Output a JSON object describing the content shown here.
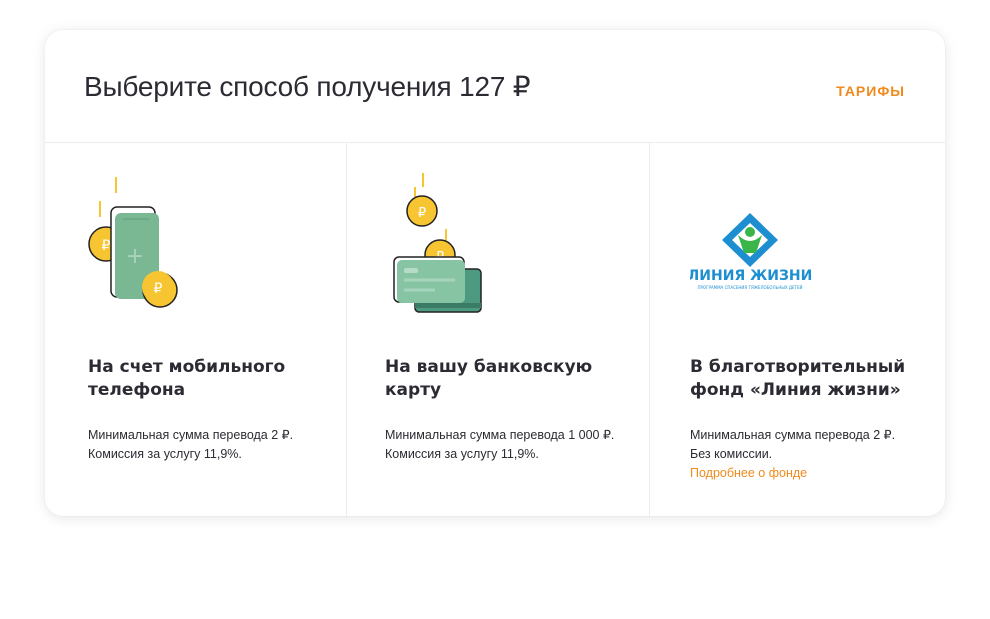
{
  "header": {
    "title": "Выберите способ получения 127 ₽",
    "tariffs_link": "ТАРИФЫ"
  },
  "options": [
    {
      "icon": "phone-with-coins-icon",
      "title": "На счет мобильного телефона",
      "min_amount": "Минимальная сумма перевода 2 ₽.",
      "commission": "Комиссия за услугу 11,9%."
    },
    {
      "icon": "bank-cards-with-coins-icon",
      "title": "На вашу банковскую карту",
      "min_amount": "Минимальная сумма перевода 1 000 ₽.",
      "commission": "Комиссия за услугу 11,9%."
    },
    {
      "icon": "liniya-zhizni-logo",
      "logo_text": "ЛИНИЯ ЖИЗНИ",
      "logo_subtitle": "ПРОГРАММА СПАСЕНИЯ ТЯЖЕЛОБОЛЬНЫХ ДЕТЕЙ",
      "title": "В благотворительный фонд «Линия жизни»",
      "min_amount": "Минимальная сумма перевода 2 ₽.",
      "commission": "Без комиссии.",
      "more_link": "Подробнее о фонде"
    }
  ],
  "coin_symbol": "₽",
  "colors": {
    "accent": "#f08a1c",
    "coin": "#f6c531",
    "phone": "#7ab893",
    "card": "#86c4a4",
    "card_back": "#4e9a80",
    "logo_blue": "#1d8fd0",
    "logo_green": "#39b54a"
  }
}
